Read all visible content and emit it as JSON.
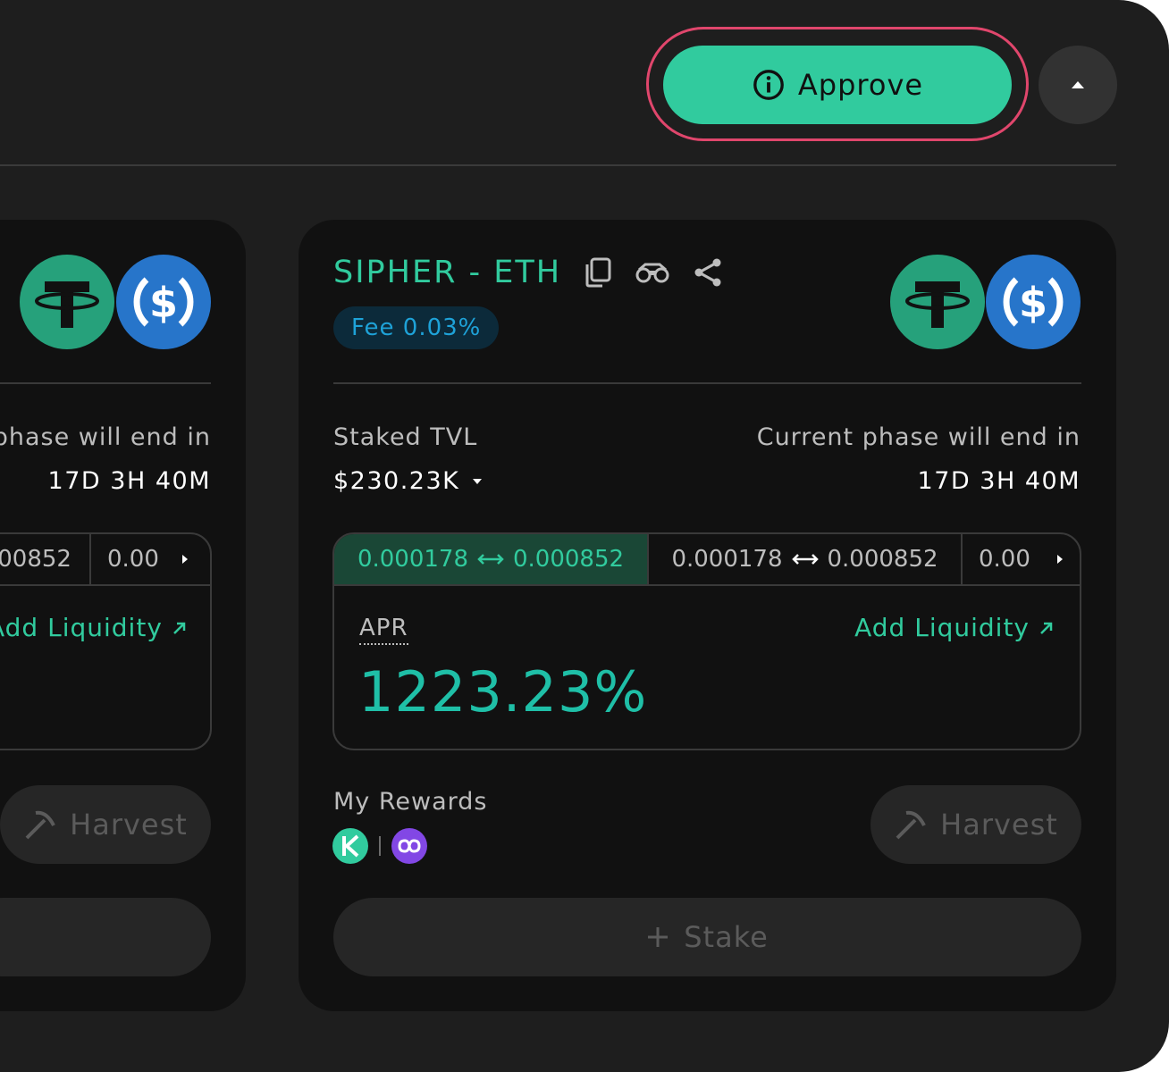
{
  "header": {
    "approve_label": "Approve",
    "accent": "#31cb9e",
    "highlight_ring": "#e0466c"
  },
  "left_card": {
    "phase_label": "phase will end in",
    "phase_value": "17D 3H 40M",
    "range_partial": "00852",
    "range_last": "0.00",
    "add_liquidity": "Add Liquidity",
    "harvest": "Harvest"
  },
  "pool": {
    "title": "SIPHER - ETH",
    "fee": "Fee 0.03%",
    "staked_tvl_label": "Staked TVL",
    "staked_tvl_value": "$230.23K",
    "phase_label": "Current phase will end in",
    "phase_value": "17D 3H 40M",
    "ranges": [
      {
        "min": "0.000178",
        "max": "0.000852",
        "active": true
      },
      {
        "min": "0.000178",
        "max": "0.000852",
        "active": false
      }
    ],
    "range_last": "0.00",
    "apr_label": "APR",
    "apr_value": "1223.23%",
    "add_liquidity": "Add Liquidity",
    "rewards_label": "My Rewards",
    "reward_tokens": [
      "kyber-icon",
      "polygon-icon"
    ],
    "harvest": "Harvest",
    "stake": "Stake"
  }
}
